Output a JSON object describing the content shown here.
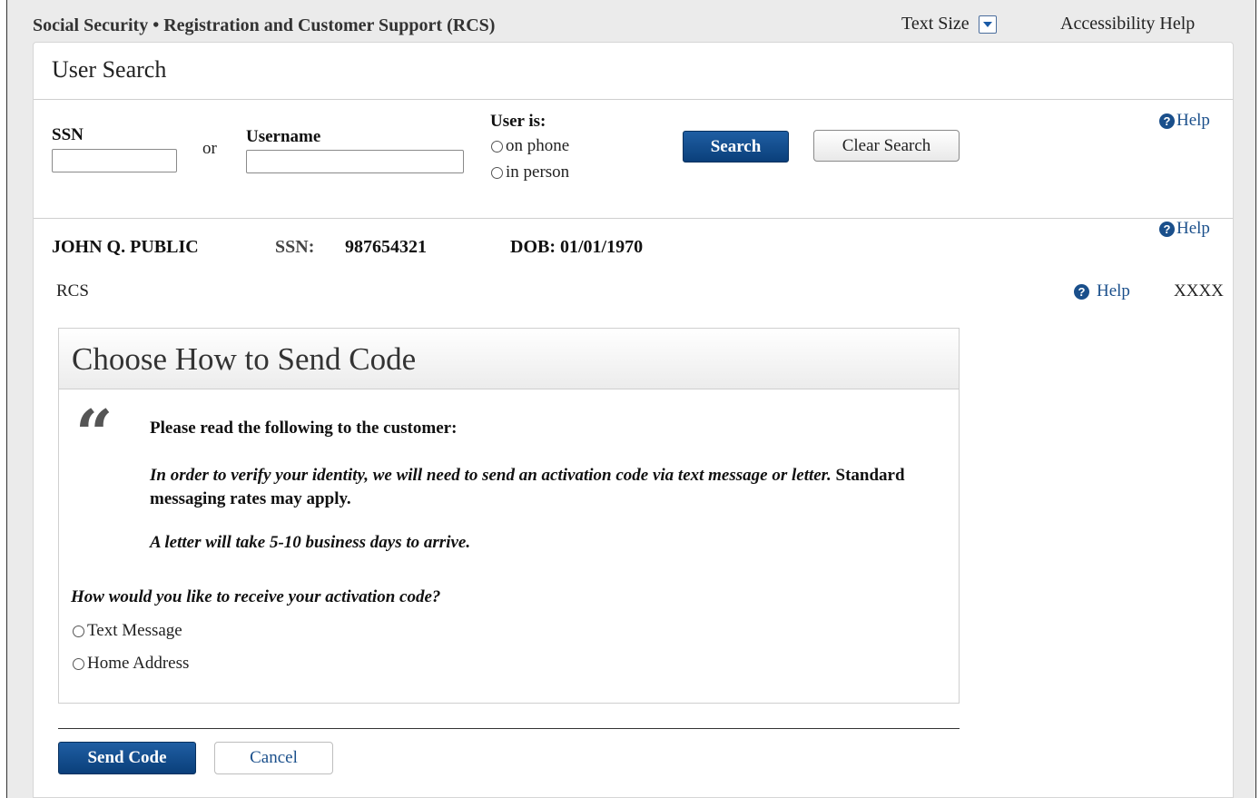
{
  "topbar": {
    "brand": "Social Security • Registration and Customer Support (RCS)",
    "text_size_label": "Text Size",
    "accessibility_help": "Accessibility Help"
  },
  "search": {
    "title": "User Search",
    "ssn_label": "SSN",
    "or_label": "or",
    "username_label": "Username",
    "ssn_value": "",
    "username_value": "",
    "user_is_label": "User is:",
    "options": [
      "on phone",
      "in person"
    ],
    "search_button": "Search",
    "clear_button": "Clear Search",
    "help_label": "Help"
  },
  "customer": {
    "name": "JOHN Q. PUBLIC",
    "ssn_label": "SSN:",
    "ssn_value": "987654321",
    "dob": "DOB: 01/01/1970",
    "help_label": "Help",
    "app_label": "RCS",
    "app_help_label": "Help",
    "masked_id": "XXXX"
  },
  "panel": {
    "title": "Choose How to Send Code",
    "instruction": "Please read the following to the customer:",
    "script_italic": "In order to verify your identity, we will need to send an activation code via text message or letter.",
    "script_plain": " Standard messaging rates may apply.",
    "letter_note": "A letter will take 5-10 business days to arrive.",
    "question": "How would you like to receive your activation code?",
    "options": [
      "Text Message",
      "Home Address"
    ]
  },
  "actions": {
    "send_code": "Send Code",
    "cancel": "Cancel"
  },
  "colors": {
    "primary": "#0a3f7a",
    "link": "#1a4f8b",
    "frame_bg": "#ebebeb"
  }
}
